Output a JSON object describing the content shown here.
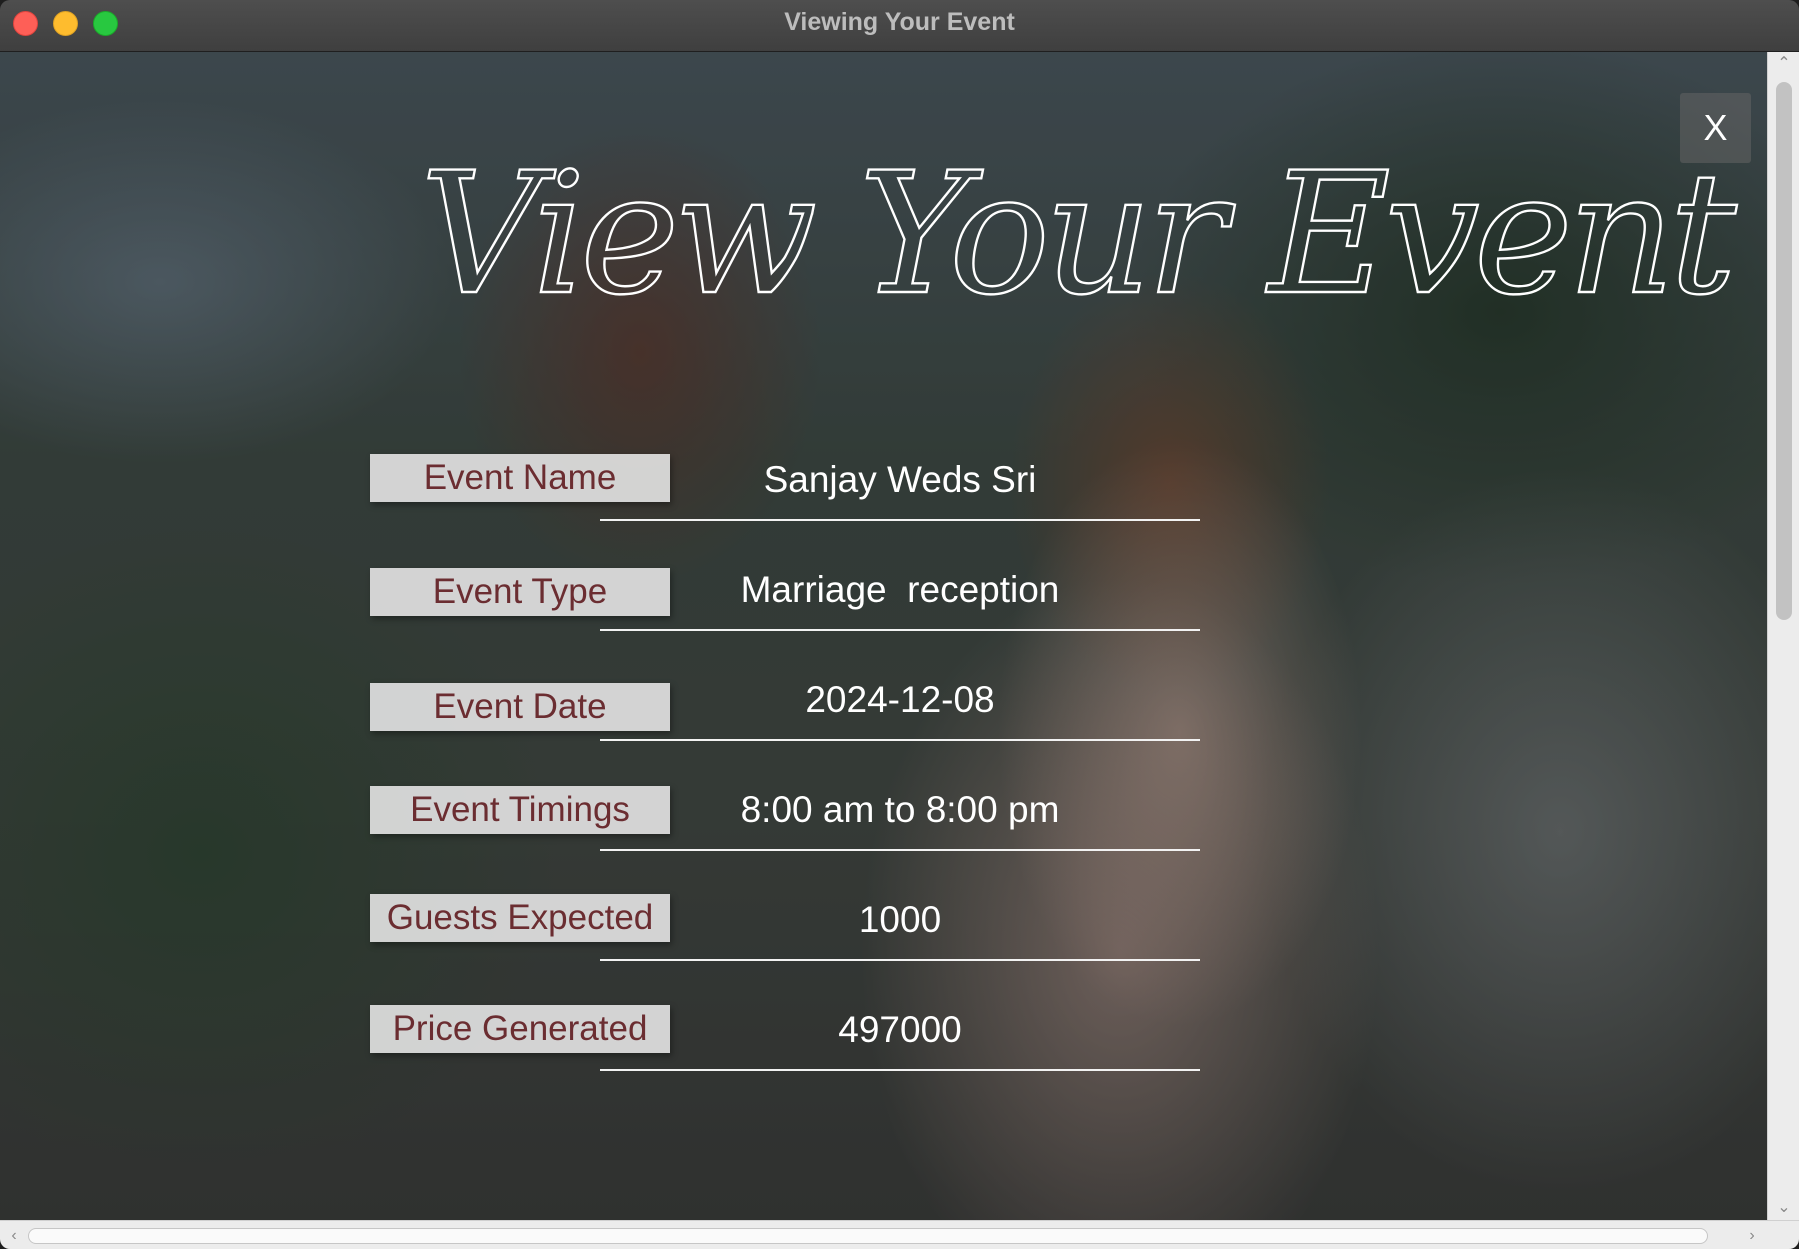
{
  "window": {
    "title": "Viewing Your Event"
  },
  "header": {
    "script_title": "View Your Event",
    "close_label": "X"
  },
  "fields": [
    {
      "label": "Event Name",
      "value": "Sanjay Weds Sri"
    },
    {
      "label": "Event Type",
      "value": "Marriage  reception"
    },
    {
      "label": "Event Date",
      "value": "2024-12-08"
    },
    {
      "label": "Event Timings",
      "value": "8:00 am to 8:00 pm"
    },
    {
      "label": "Guests Expected",
      "value": "1000"
    },
    {
      "label": "Price Generated",
      "value": "497000"
    }
  ],
  "scrollbars": {
    "up_icon": "chevron-up-icon",
    "down_icon": "chevron-down-icon",
    "left_icon": "chevron-left-icon",
    "right_icon": "chevron-right-icon"
  },
  "colors": {
    "label_text": "#6b2d31",
    "label_bg": "#e4e4e4",
    "value_text": "#ffffff"
  }
}
